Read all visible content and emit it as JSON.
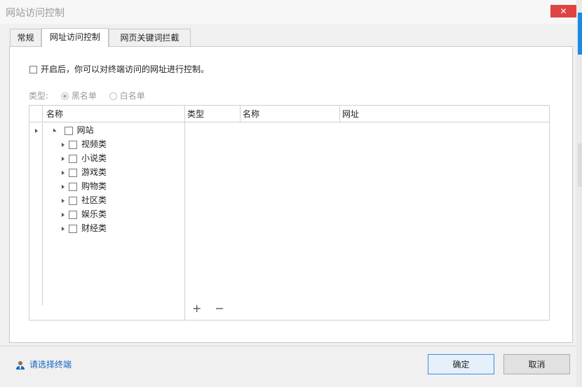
{
  "window": {
    "title": "网站访问控制",
    "close_icon": "✕"
  },
  "tabs": [
    {
      "label": "常规",
      "active": false
    },
    {
      "label": "网址访问控制",
      "active": true
    },
    {
      "label": "网页关键词拦截",
      "active": false
    }
  ],
  "enable": {
    "label": "开启后，你可以对终端访问的网址进行控制。",
    "checked": false
  },
  "type": {
    "label": "类型:",
    "options": [
      {
        "label": "黑名单",
        "checked": true
      },
      {
        "label": "白名单",
        "checked": false
      }
    ]
  },
  "left_list": {
    "header": "名称",
    "root": {
      "label": "网站"
    },
    "children": [
      {
        "label": "视频类"
      },
      {
        "label": "小说类"
      },
      {
        "label": "游戏类"
      },
      {
        "label": "购物类"
      },
      {
        "label": "社区类"
      },
      {
        "label": "娱乐类"
      },
      {
        "label": "财经类"
      }
    ]
  },
  "right_list": {
    "columns": [
      "类型",
      "名称",
      "网址"
    ],
    "add_icon": "+",
    "remove_icon": "−"
  },
  "footer": {
    "select_terminal": "请选择终端",
    "ok": "确定",
    "cancel": "取消"
  },
  "colors": {
    "accent": "#1e88e5",
    "close": "#e04343",
    "link": "#1565c0"
  }
}
